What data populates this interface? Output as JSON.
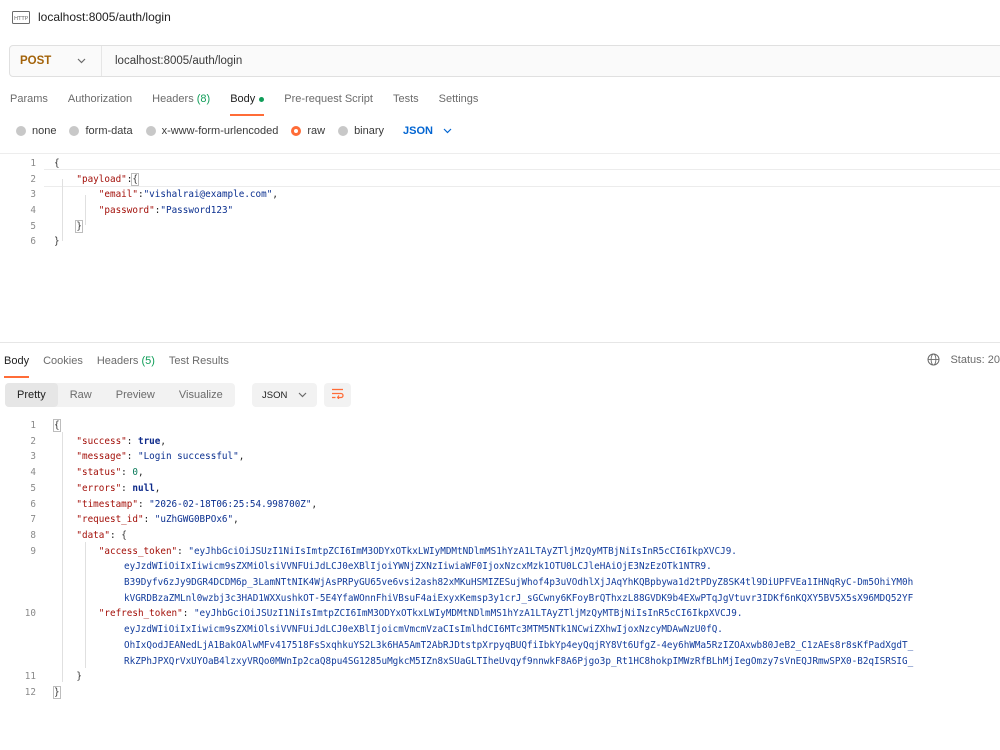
{
  "request": {
    "title": "localhost:8005/auth/login",
    "method": "POST",
    "url": "localhost:8005/auth/login"
  },
  "request_tabs": [
    {
      "label": "Params"
    },
    {
      "label": "Authorization"
    },
    {
      "label": "Headers",
      "count": "(8)"
    },
    {
      "label": "Body"
    },
    {
      "label": "Pre-request Script"
    },
    {
      "label": "Tests"
    },
    {
      "label": "Settings"
    }
  ],
  "body_types": [
    "none",
    "form-data",
    "x-www-form-urlencoded",
    "raw",
    "binary"
  ],
  "body_language": "JSON",
  "request_body": {
    "line_numbers": [
      "1",
      "2",
      "3",
      "4",
      "5",
      "6"
    ],
    "open_brace": "{",
    "payload_key": "\"payload\"",
    "email_key": "\"email\"",
    "email_value": "\"vishalrai@example.com\"",
    "password_key": "\"password\"",
    "password_value": "\"Password123\"",
    "close_brace": "}"
  },
  "response_tabs": [
    {
      "label": "Body"
    },
    {
      "label": "Cookies"
    },
    {
      "label": "Headers",
      "count": "(5)"
    },
    {
      "label": "Test Results"
    }
  ],
  "response_status": "Status: 20",
  "view_modes": [
    "Pretty",
    "Raw",
    "Preview",
    "Visualize"
  ],
  "response_format": "JSON",
  "response_body": {
    "line_numbers": [
      "1",
      "2",
      "3",
      "4",
      "5",
      "6",
      "7",
      "8",
      "9",
      "10",
      "11",
      "12"
    ],
    "success_key": "\"success\"",
    "success_value": "true",
    "message_key": "\"message\"",
    "message_value": "\"Login successful\"",
    "status_key": "\"status\"",
    "status_value": "0",
    "errors_key": "\"errors\"",
    "errors_value": "null",
    "timestamp_key": "\"timestamp\"",
    "timestamp_value": "\"2026-02-18T06:25:54.998700Z\"",
    "request_id_key": "\"request_id\"",
    "request_id_value": "\"uZhGWG0BPOx6\"",
    "data_key": "\"data\"",
    "access_token_key": "\"access_token\"",
    "access_token_lines": [
      "\"eyJhbGciOiJSUzI1NiIsImtpZCI6ImM3ODYxOTkxLWIyMDMtNDlmMS1hYzA1LTAyZTljMzQyMTBjNiIsInR5cCI6IkpXVCJ9.",
      "eyJzdWIiOiIxIiwicm9sZXMiOlsiVVNFUiJdLCJ0eXBlIjoiYWNjZXNzIiwiaWF0IjoxNzcxMzk1OTU0LCJleHAiOjE3NzEzOTk1NTR9.",
      "B39Dyfv6zJy9DGR4DCDM6p_3LamNTtNIK4WjAsPRPyGU65ve6vsi2ash82xMKuHSMIZESujWhof4p3uVOdhlXjJAqYhKQBpbywa1d2tPDyZ8SK4tl9DiUPFVEa1IHNqRyC-Dm5OhiYM0h",
      "kVGRDBzaZMLnl0wzbj3c3HAD1WXXushkOT-5E4YfaWOnnFhiVBsuF4aiExyxKemsp3y1crJ_sGCwny6KFoyBrQThxzL88GVDK9b4EXwPTqJgVtuvr3IDKf6nKQXY5BV5X5sX96MDQ52YF"
    ],
    "refresh_token_key": "\"refresh_token\"",
    "refresh_token_lines": [
      "\"eyJhbGciOiJSUzI1NiIsImtpZCI6ImM3ODYxOTkxLWIyMDMtNDlmMS1hYzA1LTAyZTljMzQyMTBjNiIsInR5cCI6IkpXVCJ9.",
      "eyJzdWIiOiIxIiwicm9sZXMiOlsiVVNFUiJdLCJ0eXBlIjoicmVmcmVzaCIsImlhdCI6MTc3MTM5NTk1NCwiZXhwIjoxNzcyMDAwNzU0fQ.",
      "OhIxQodJEANedLjA1BakOAlwMFv417518FsSxqhkuYS2L3k6HA5AmT2AbRJDtstpXrpyqBUQfiIbkYp4eyQqjRY8Vt6UfgZ-4ey6hWMa5RzIZOAxwb80JeB2_C1zAEs8r8sKfPadXgdT_",
      "RkZPhJPXQrVxUYOaB4lzxyVRQo0MWnIp2caQ8pu4SG1285uMgkcM5IZn8xSUaGLTIheUvqyf9nnwkF8A6Pjgo3p_Rt1HC8hokpIMWzRfBLhMjIegOmzy7sVnEQJRmwSPX0-B2qISRSIG_"
    ],
    "open_brace": "{",
    "close_brace": "}"
  }
}
